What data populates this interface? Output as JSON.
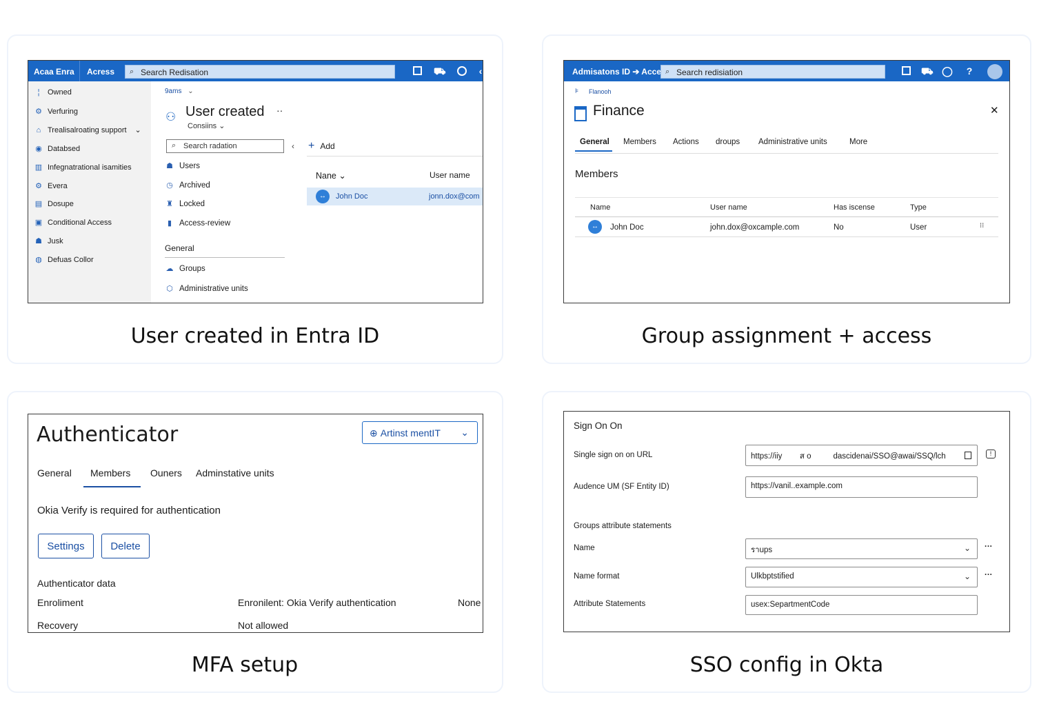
{
  "panels": {
    "entra": {
      "caption": "User created in Entra ID",
      "topbar": {
        "brand": "Acaa Enra",
        "nav": "Acress",
        "search_placeholder": "Search Redisation"
      },
      "sidebar": [
        {
          "label": "Owned",
          "icon": "marker-icon"
        },
        {
          "label": "Verfuring",
          "icon": "gear-icon"
        },
        {
          "label": "Trealisalroating support",
          "icon": "support-icon"
        },
        {
          "label": "Databsed",
          "icon": "location-icon"
        },
        {
          "label": "Infegnatrational isamities",
          "icon": "chart-icon"
        },
        {
          "label": "Evera",
          "icon": "gear-icon"
        },
        {
          "label": "Dosupe",
          "icon": "building-icon"
        },
        {
          "label": "Conditional Access",
          "icon": "shield-icon"
        },
        {
          "label": "Jusk",
          "icon": "users-icon"
        },
        {
          "label": "Defuas Collor",
          "icon": "circle-icon"
        }
      ],
      "breadcrumb": "9ams",
      "title": "User created",
      "subtitle": "Consiins",
      "search_placeholder": "Search radation",
      "menu": [
        {
          "label": "Users",
          "icon": "users-icon"
        },
        {
          "label": "Archived",
          "icon": "clock-icon"
        },
        {
          "label": "Locked",
          "icon": "lock-icon"
        },
        {
          "label": "Access-review",
          "icon": "document-icon"
        }
      ],
      "section": "General",
      "menu2": [
        {
          "label": "Groups",
          "icon": "group-icon"
        },
        {
          "label": "Administrative units",
          "icon": "admin-icon"
        }
      ],
      "add_label": "Add",
      "table": {
        "headers": [
          "Nane",
          "User name"
        ],
        "rows": [
          {
            "name": "John Doc",
            "username": "jonn.dox@com"
          }
        ]
      }
    },
    "group": {
      "caption": "Group assignment + access",
      "topbar": {
        "brand": "Admisatons ID ➔ Access",
        "search_placeholder": "Search redisiation"
      },
      "breadcrumb": "Flanooh",
      "title": "Finance",
      "tabs": [
        "General",
        "Members",
        "Actions",
        "droups",
        "Administrative units",
        "More"
      ],
      "section": "Members",
      "table": {
        "headers": [
          "Name",
          "User name",
          "Has iscense",
          "Type"
        ],
        "rows": [
          {
            "name": "John Doc",
            "username": "john.dox@oxcample.com",
            "license": "No",
            "type": "User"
          }
        ]
      }
    },
    "mfa": {
      "caption": "MFA setup",
      "title": "Authenticator",
      "dropdown": "Artinst mentIT",
      "tabs": [
        "General",
        "Members",
        "Ouners",
        "Adminstative units"
      ],
      "message": "Okia Verify is required for authentication",
      "buttons": {
        "settings": "Settings",
        "delete": "Delete"
      },
      "data_heading": "Authenticator data",
      "rows": [
        {
          "label": "Enroliment",
          "value": "Enronilent: Okia Verify authentication",
          "extra": "None"
        },
        {
          "label": "Recovery",
          "value": "Not allowed",
          "extra": ""
        }
      ]
    },
    "sso": {
      "caption": "SSO config in Okta",
      "heading": "Sign On On",
      "fields": [
        {
          "label": "Single sign on on URL",
          "value": "https://iiy        ส o          dascidenai/SSO@awai/SSQ/lch"
        },
        {
          "label": "Audence UM (SF Entity ID)",
          "value": "https://vanil..example.com"
        }
      ],
      "groups_heading": "Groups attribute statements",
      "attrs": [
        {
          "label": "Name",
          "value": "ราups",
          "type": "select"
        },
        {
          "label": "Name format",
          "value": "Ulkbptstified",
          "type": "select"
        },
        {
          "label": "Attribute Statements",
          "value": "usex:SepartmentCode",
          "type": "text"
        }
      ]
    }
  },
  "colors": {
    "accent": "#1a67c5",
    "link": "#1a4fa3",
    "highlight": "#dbe9f8"
  }
}
